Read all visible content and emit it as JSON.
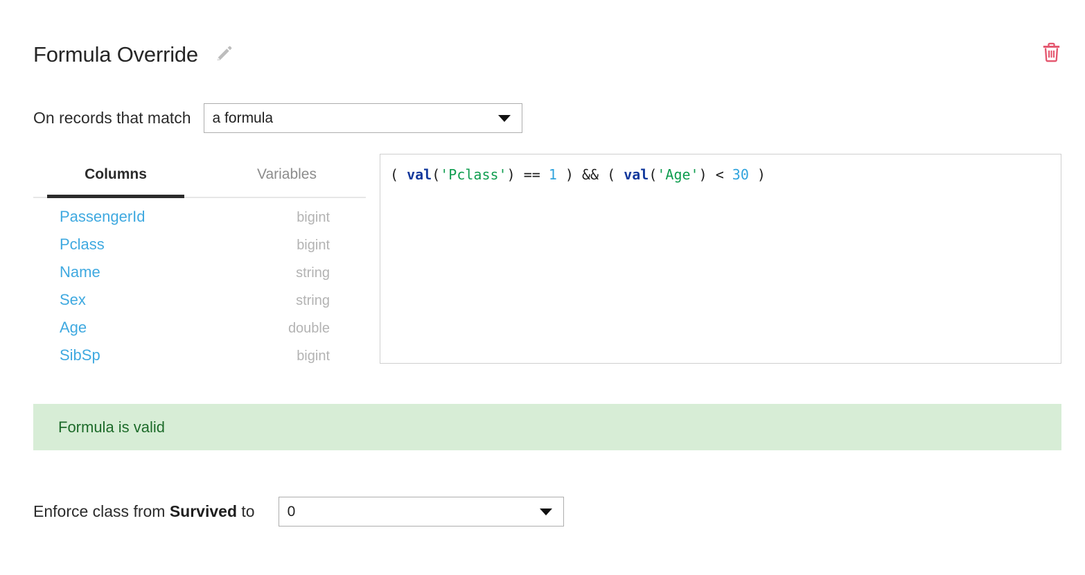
{
  "header": {
    "title": "Formula Override",
    "edit_icon": "pencil-icon",
    "delete_icon": "trash-icon",
    "delete_color": "#e4566e",
    "edit_color": "#bdbdbd"
  },
  "match": {
    "label": "On records that match",
    "selected": "a formula",
    "options": [
      "a formula"
    ]
  },
  "panel": {
    "tabs": [
      {
        "label": "Columns",
        "active": true
      },
      {
        "label": "Variables",
        "active": false
      }
    ],
    "columns": [
      {
        "name": "PassengerId",
        "type": "bigint"
      },
      {
        "name": "Pclass",
        "type": "bigint"
      },
      {
        "name": "Name",
        "type": "string"
      },
      {
        "name": "Sex",
        "type": "string"
      },
      {
        "name": "Age",
        "type": "double"
      },
      {
        "name": "SibSp",
        "type": "bigint"
      }
    ],
    "column_name_color": "#3fa9e0",
    "column_type_color": "#b3b3b3"
  },
  "editor": {
    "formula": "( val('Pclass') == 1 ) && ( val('Age') < 30 )",
    "tokens": [
      {
        "text": "( ",
        "kind": "punct"
      },
      {
        "text": "val",
        "kind": "fn"
      },
      {
        "text": "(",
        "kind": "punct"
      },
      {
        "text": "'Pclass'",
        "kind": "str"
      },
      {
        "text": ") ",
        "kind": "punct"
      },
      {
        "text": "== ",
        "kind": "op"
      },
      {
        "text": "1",
        "kind": "num"
      },
      {
        "text": " ) ",
        "kind": "punct"
      },
      {
        "text": "&& ",
        "kind": "op"
      },
      {
        "text": "( ",
        "kind": "punct"
      },
      {
        "text": "val",
        "kind": "fn"
      },
      {
        "text": "(",
        "kind": "punct"
      },
      {
        "text": "'Age'",
        "kind": "str"
      },
      {
        "text": ") ",
        "kind": "punct"
      },
      {
        "text": "< ",
        "kind": "op"
      },
      {
        "text": "30",
        "kind": "num"
      },
      {
        "text": " )",
        "kind": "punct"
      }
    ],
    "token_colors": {
      "function": "#12399c",
      "string": "#0f9d4f",
      "number": "#2fa3dd",
      "punctuation": "#1c1c1c"
    }
  },
  "validation": {
    "message": "Formula is valid",
    "background": "#d7edd6",
    "text_color": "#1d6b2a"
  },
  "enforce": {
    "prefix": "Enforce class from ",
    "target_column": "Survived",
    "suffix": " to",
    "selected": "0",
    "options": [
      "0"
    ]
  }
}
